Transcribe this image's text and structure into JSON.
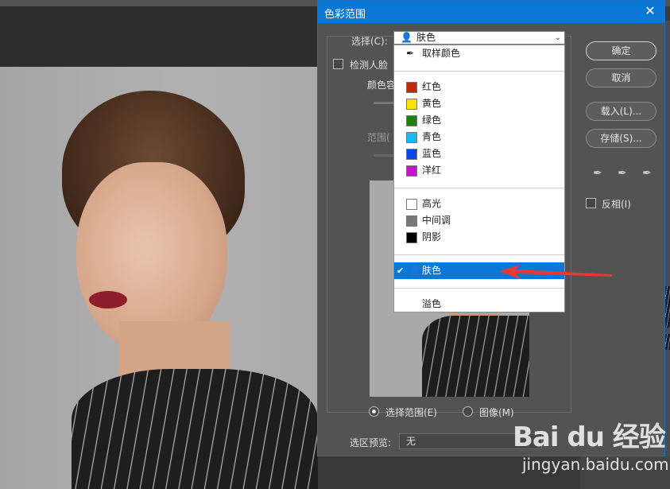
{
  "dialog": {
    "title": "色彩范围",
    "close_glyph": "✕",
    "select_label": "选择(C):",
    "select_value": "肤色",
    "detect_faces_label": "检测人脸",
    "fuzziness_label": "颜色容",
    "range_label": "范围(",
    "radio_selection_label": "选择范围(E)",
    "radio_image_label": "图像(M)",
    "preview_label": "选区预览:",
    "preview_value": "无",
    "invert_label": "反相(I)",
    "buttons": {
      "ok": "确定",
      "cancel": "取消",
      "load": "载入(L)...",
      "save": "存储(S)..."
    }
  },
  "dropdown": {
    "items": [
      {
        "label": "取样颜色",
        "icon": "eyedropper-icon"
      },
      {
        "label": "红色",
        "color": "#c0280f"
      },
      {
        "label": "黄色",
        "color": "#ffe100"
      },
      {
        "label": "绿色",
        "color": "#1d7f0e"
      },
      {
        "label": "青色",
        "color": "#1ab9f0"
      },
      {
        "label": "蓝色",
        "color": "#0a46e6"
      },
      {
        "label": "洋红",
        "color": "#c017c8"
      },
      {
        "label": "高光",
        "color": "#ffffff"
      },
      {
        "label": "中间调",
        "color": "#777777"
      },
      {
        "label": "阴影",
        "color": "#000000"
      },
      {
        "label": "肤色",
        "icon": "person-icon",
        "selected": true
      },
      {
        "label": "溢色"
      }
    ]
  },
  "watermark": {
    "logo": "Bai du 经验",
    "url": "jingyan.baidu.com"
  },
  "colors": {
    "accent": "#0b78d7",
    "arrow": "#e53935"
  }
}
